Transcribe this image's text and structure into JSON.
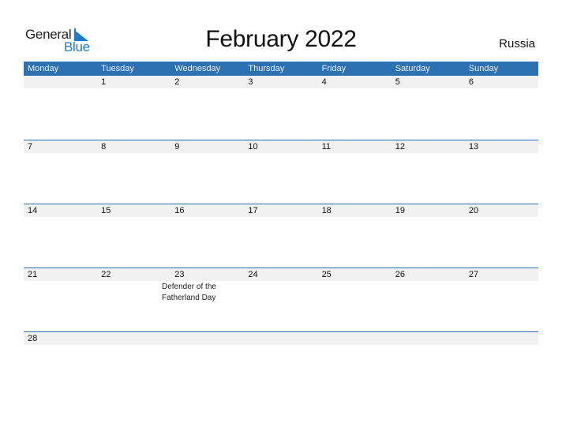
{
  "logo": {
    "part1": "General",
    "part2": "Blue",
    "accent_color": "#1f7ac4"
  },
  "title": "February 2022",
  "country": "Russia",
  "header_color": "#2e71b3",
  "weekdays": [
    "Monday",
    "Tuesday",
    "Wednesday",
    "Thursday",
    "Friday",
    "Saturday",
    "Sunday"
  ],
  "weeks": [
    {
      "days": [
        "",
        "1",
        "2",
        "3",
        "4",
        "5",
        "6"
      ],
      "events": [
        "",
        "",
        "",
        "",
        "",
        "",
        ""
      ]
    },
    {
      "days": [
        "7",
        "8",
        "9",
        "10",
        "11",
        "12",
        "13"
      ],
      "events": [
        "",
        "",
        "",
        "",
        "",
        "",
        ""
      ]
    },
    {
      "days": [
        "14",
        "15",
        "16",
        "17",
        "18",
        "19",
        "20"
      ],
      "events": [
        "",
        "",
        "",
        "",
        "",
        "",
        ""
      ]
    },
    {
      "days": [
        "21",
        "22",
        "23",
        "24",
        "25",
        "26",
        "27"
      ],
      "events": [
        "",
        "",
        "Defender of the Fatherland Day",
        "",
        "",
        "",
        ""
      ]
    },
    {
      "days": [
        "28",
        "",
        "",
        "",
        "",
        "",
        ""
      ],
      "events": [
        "",
        "",
        "",
        "",
        "",
        "",
        ""
      ]
    }
  ]
}
